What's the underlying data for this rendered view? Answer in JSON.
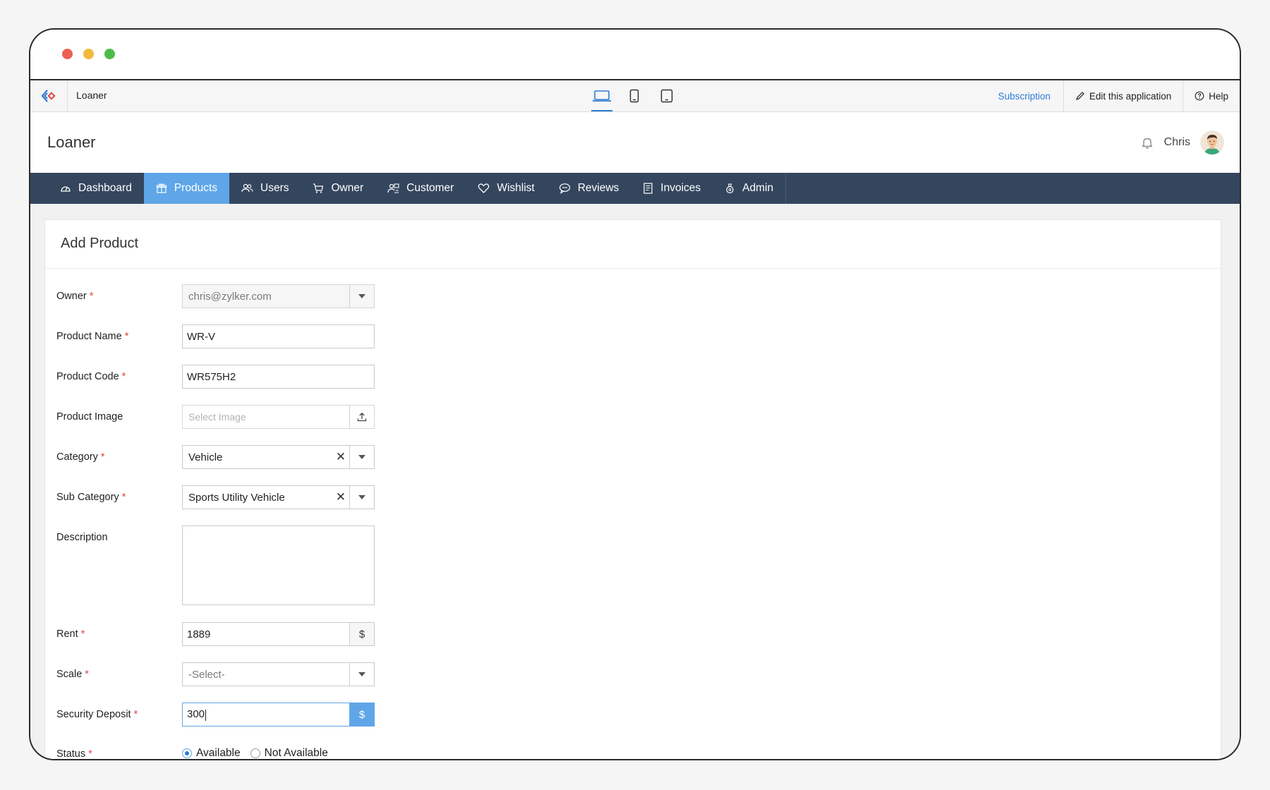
{
  "app": {
    "name": "Loaner",
    "subscription_label": "Subscription",
    "edit_label": "Edit this application",
    "help_label": "Help"
  },
  "header": {
    "title": "Loaner",
    "user_name": "Chris"
  },
  "nav": {
    "items": [
      {
        "label": "Dashboard",
        "icon": "dashboard-icon"
      },
      {
        "label": "Products",
        "icon": "gift-icon",
        "active": true
      },
      {
        "label": "Users",
        "icon": "users-icon"
      },
      {
        "label": "Owner",
        "icon": "cart-icon"
      },
      {
        "label": "Customer",
        "icon": "customer-icon"
      },
      {
        "label": "Wishlist",
        "icon": "heart-icon"
      },
      {
        "label": "Reviews",
        "icon": "chat-icon"
      },
      {
        "label": "Invoices",
        "icon": "invoice-icon"
      },
      {
        "label": "Admin",
        "icon": "admin-icon"
      }
    ]
  },
  "form": {
    "title": "Add Product",
    "required_marker": "*",
    "owner": {
      "label": "Owner",
      "value": "chris@zylker.com"
    },
    "product_name": {
      "label": "Product Name",
      "value": "WR-V"
    },
    "product_code": {
      "label": "Product Code",
      "value": "WR575H2"
    },
    "product_image": {
      "label": "Product Image",
      "placeholder": "Select Image"
    },
    "category": {
      "label": "Category",
      "value": "Vehicle"
    },
    "sub_category": {
      "label": "Sub Category",
      "value": "Sports Utility Vehicle"
    },
    "description": {
      "label": "Description",
      "value": ""
    },
    "rent": {
      "label": "Rent",
      "value": "1889",
      "currency": "$"
    },
    "scale": {
      "label": "Scale",
      "value": "-Select-"
    },
    "security_deposit": {
      "label": "Security Deposit",
      "value": "300",
      "currency": "$"
    },
    "status": {
      "label": "Status",
      "options": [
        "Available",
        "Not Available"
      ],
      "selected": "Available"
    }
  },
  "colors": {
    "nav_bg": "#34465e",
    "nav_active": "#5fa6e8",
    "link": "#2e7bd6",
    "required": "#e04646"
  }
}
